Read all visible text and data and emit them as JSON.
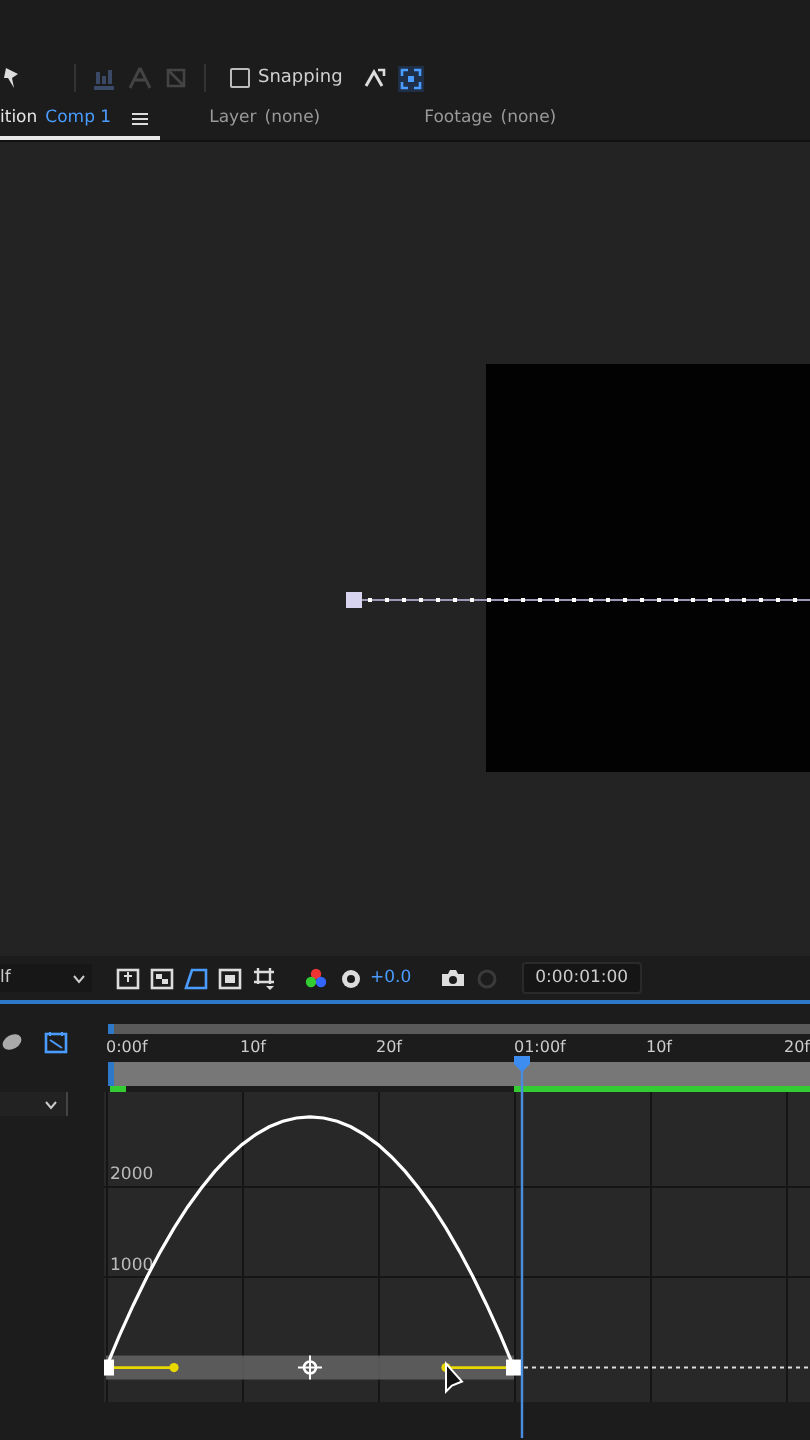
{
  "toolbar": {
    "snapping": {
      "label": "Snapping",
      "checked": false
    }
  },
  "tabs": [
    {
      "prefix": "ition",
      "name": "Comp 1",
      "selected": true
    },
    {
      "prefix": "Layer",
      "name": "(none)",
      "selected": false
    },
    {
      "prefix": "Footage",
      "name": "(none)",
      "selected": false
    }
  ],
  "viewer_bar": {
    "resolution": "lf",
    "exposure": "+0.0",
    "timecode": "0:00:01:00"
  },
  "timeline": {
    "ruler": [
      "0:00f",
      "10f",
      "20f",
      "01:00f",
      "10f",
      "20f"
    ],
    "graph": {
      "value_labels": [
        "2000",
        "1000"
      ]
    }
  }
}
